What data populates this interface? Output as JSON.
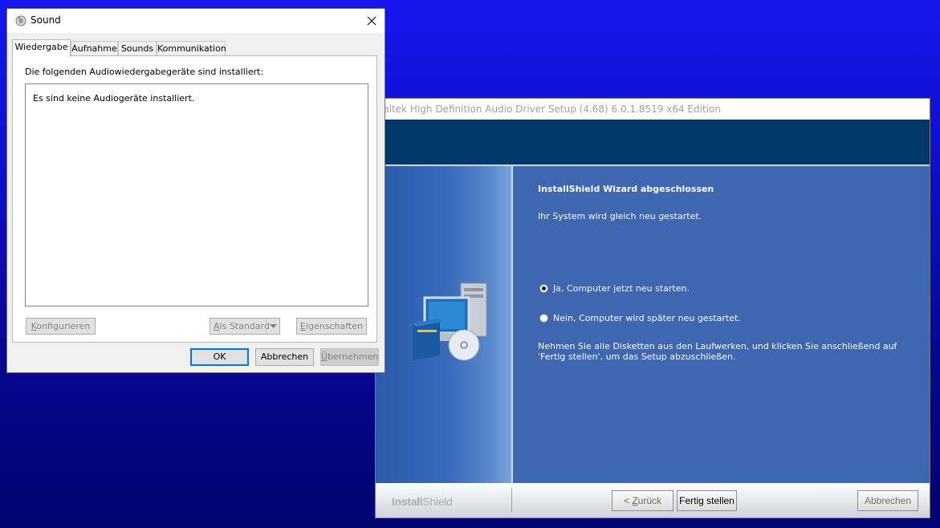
{
  "installshield": {
    "title": "ealtek High Definition Audio Driver Setup (4.68) 6.0.1.8519  x64 Edition",
    "heading": "InstallShield Wizard abgeschlossen",
    "subtitle": "Ihr System wird gleich neu gestartet.",
    "radio_options": [
      {
        "label": "Ja, Computer jetzt neu starten.",
        "checked": true
      },
      {
        "label": "Nein, Computer wird später neu gestartet.",
        "checked": false
      }
    ],
    "instructions": "Nehmen Sie alle Disketten aus den Laufwerken, und klicken Sie anschließend auf 'Fertig stellen', um das Setup abzuschließen.",
    "logo_bold": "Install",
    "logo_light": "Shield",
    "buttons": {
      "back_prefix": "< ",
      "back_underlined": "Z",
      "back_rest": "urück",
      "finish": "Fertig stellen",
      "cancel": "Abbrechen"
    },
    "colors": {
      "header": "#003869",
      "panel": "#3f66b0"
    }
  },
  "sound": {
    "title": "Sound",
    "tabs": [
      "Wiedergabe",
      "Aufnahme",
      "Sounds",
      "Kommunikation"
    ],
    "active_tab": "Wiedergabe",
    "caption": "Die folgenden Audiowiedergabegeräte sind installiert:",
    "empty_message": "Es sind keine Audiogeräte installiert.",
    "buttons": {
      "configure_u": "K",
      "configure_rest": "onfigurieren",
      "set_default_u": "A",
      "set_default_rest": "ls Standard",
      "properties_u": "E",
      "properties_rest": "igenschaften",
      "ok": "OK",
      "cancel": "Abbrechen",
      "apply_u": "Ü",
      "apply_rest": "bernehmen"
    }
  }
}
